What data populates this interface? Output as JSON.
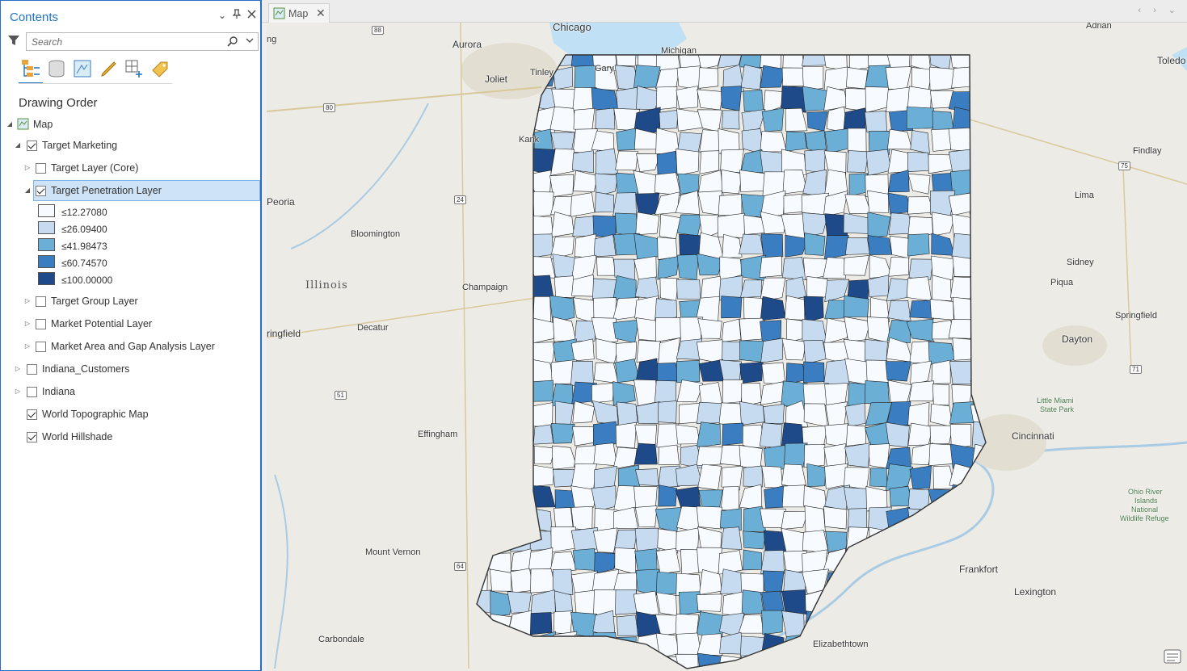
{
  "contents": {
    "title": "Contents",
    "search_placeholder": "Search",
    "section_title": "Drawing Order",
    "map_label": "Map",
    "layers": {
      "target_marketing": "Target Marketing",
      "target_layer_core": "Target Layer (Core)",
      "target_penetration": "Target Penetration Layer",
      "target_group": "Target Group Layer",
      "market_potential": "Market Potential Layer",
      "market_area_gap": "Market Area and Gap Analysis Layer",
      "indiana_customers": "Indiana_Customers",
      "indiana": "Indiana",
      "world_topo": "World Topographic Map",
      "world_hillshade": "World Hillshade"
    },
    "legend": [
      {
        "label": "≤12.27080",
        "color": "#f7fbff"
      },
      {
        "label": "≤26.09400",
        "color": "#c6dbef"
      },
      {
        "label": "≤41.98473",
        "color": "#6baed6"
      },
      {
        "label": "≤60.74570",
        "color": "#3a7dc0"
      },
      {
        "label": "≤100.00000",
        "color": "#1f4a8a"
      }
    ]
  },
  "map": {
    "tab_label": "Map",
    "state_label": "Illinois",
    "places": {
      "chicago": "Chicago",
      "aurora": "Aurora",
      "joliet": "Joliet",
      "gary": "Gary",
      "tinley": "Tinley",
      "michigan": "Michigan",
      "kankakee": "Kank",
      "peoria": "Peoria",
      "bloomington": "Bloomington",
      "champaign": "Champaign",
      "decatur": "Decatur",
      "springfield_il": "ringfield",
      "effingham": "Effingham",
      "mount_vernon": "Mount Vernon",
      "carbondale": "Carbondale",
      "toledo": "Toledo",
      "adrian": "Adrian",
      "findlay": "Findlay",
      "lima": "Lima",
      "sidney": "Sidney",
      "piqua": "Piqua",
      "springfield_oh": "Springfield",
      "dayton": "Dayton",
      "little_miami": "Little Miami",
      "state_park": "State Park",
      "cincinnati": "Cincinnati",
      "ohio_river_1": "Ohio River",
      "ohio_river_2": "Islands",
      "ohio_river_3": "National",
      "ohio_river_4": "Wildlife Refuge",
      "frankfort": "Frankfort",
      "lexington": "Lexington",
      "elizabethtown": "Elizabethtown",
      "ng": "ng"
    },
    "highways": [
      "88",
      "80",
      "24",
      "51",
      "64",
      "75",
      "71"
    ]
  }
}
